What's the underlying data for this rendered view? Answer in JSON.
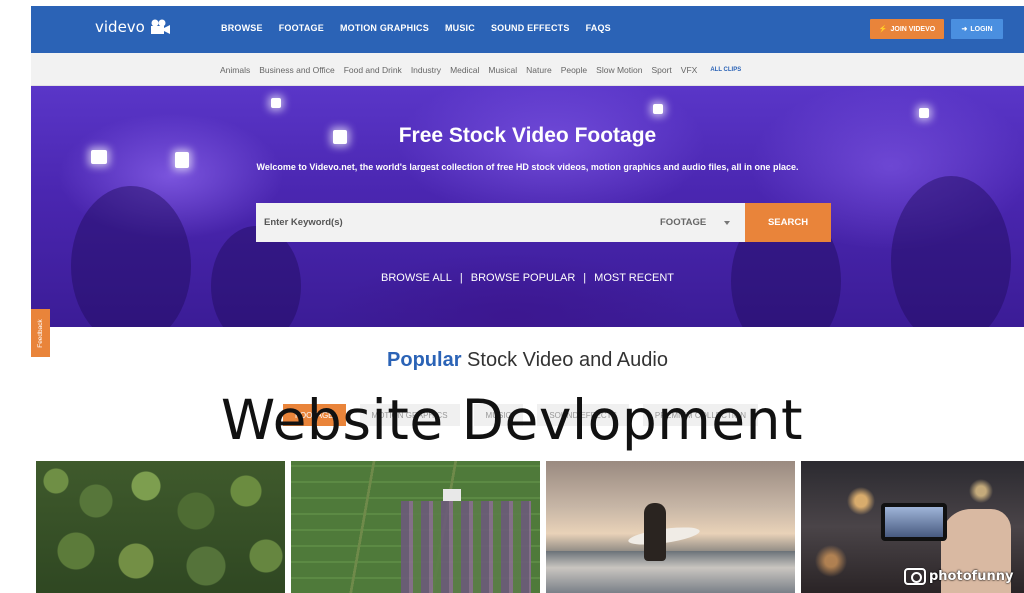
{
  "header": {
    "logo_text": "videvo",
    "nav": [
      "BROWSE",
      "FOOTAGE",
      "MOTION GRAPHICS",
      "MUSIC",
      "SOUND EFFECTS",
      "FAQS"
    ],
    "join_label": "JOIN VIDEVO",
    "login_label": "LOGIN",
    "brand_color": "#2b63b6",
    "accent_color": "#e9843a"
  },
  "categories": {
    "items": [
      "Animals",
      "Business and Office",
      "Food and Drink",
      "Industry",
      "Medical",
      "Musical",
      "Nature",
      "People",
      "Slow Motion",
      "Sport",
      "VFX"
    ],
    "all_label": "ALL CLIPS"
  },
  "hero": {
    "title": "Free Stock Video Footage",
    "subtitle": "Welcome to Videvo.net, the world's largest collection of free HD stock videos, motion graphics and audio files, all in one place.",
    "search_placeholder": "Enter Keyword(s)",
    "search_type": "FOOTAGE",
    "search_button": "SEARCH",
    "links": [
      "BROWSE ALL",
      "BROWSE POPULAR",
      "MOST RECENT"
    ]
  },
  "feedback_label": "Feedback",
  "popular": {
    "strong": "Popular",
    "rest": "Stock Video and Audio"
  },
  "tabs": [
    "FOOTAGE",
    "MOTION GRAPHICS",
    "MUSIC",
    "SOUND EFFECTS",
    "PREMIUM COLLECTION"
  ],
  "overlay_text": "Website Devlopment",
  "thumbnails": [
    "forest-aerial",
    "farmland-aerial",
    "surfer-sunset",
    "phone-city-night"
  ],
  "watermark": "photofunny"
}
